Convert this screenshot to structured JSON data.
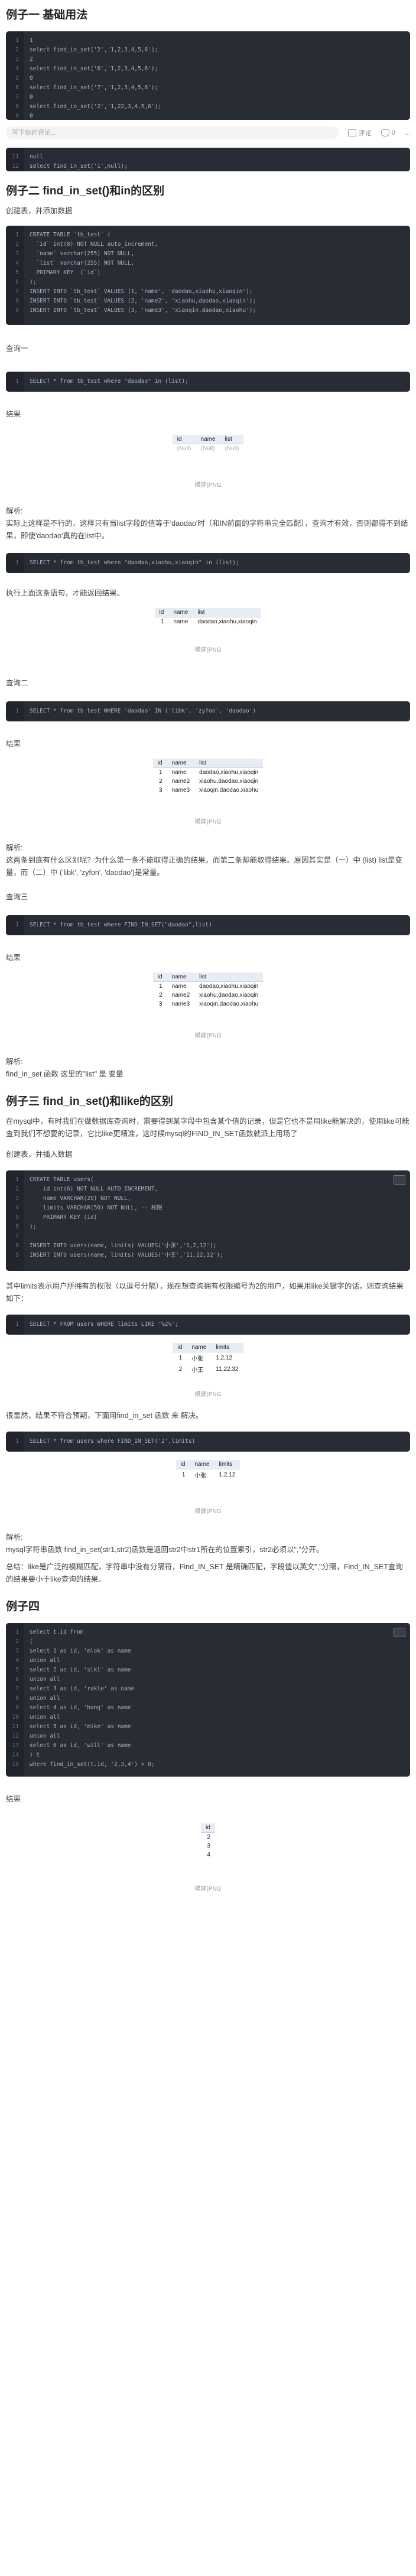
{
  "example1": {
    "title": "例子一 基础用法",
    "code_top": [
      {
        "n": "1",
        "t": "1"
      },
      {
        "n": "2",
        "t": "select find_in_set('2','1,2,3,4,5,6');"
      },
      {
        "n": "3",
        "t": "2"
      },
      {
        "n": "4",
        "t": "select find_in_set('6','1,2,3,4,5,6');"
      },
      {
        "n": "5",
        "t": "0"
      },
      {
        "n": "6",
        "t": "select find_in_set('7','1,2,3,4,5,6');"
      },
      {
        "n": "7",
        "t": "0"
      },
      {
        "n": "8",
        "t": "select find_in_set('2','1,22,3,4,5,6');"
      },
      {
        "n": "9",
        "t": "0"
      }
    ],
    "code_bottom": [
      {
        "n": "11",
        "t": "null"
      },
      {
        "n": "12",
        "t": "select find_in_set('1',null);"
      }
    ]
  },
  "toolbar": {
    "comment_placeholder": "写下你的评论...",
    "comment_label": "评论",
    "like_label": "0",
    "more_label": "..."
  },
  "example2": {
    "title": "例子二 find_in_set()和in的区别",
    "intro": "创建表，并添加数据",
    "code": [
      {
        "n": "1",
        "t": "CREATE TABLE `tb_test` ("
      },
      {
        "n": "2",
        "t": "  `id` int(8) NOT NULL auto_increment,"
      },
      {
        "n": "3",
        "t": "  `name` varchar(255) NOT NULL,"
      },
      {
        "n": "4",
        "t": "  `list` varchar(255) NOT NULL,"
      },
      {
        "n": "5",
        "t": "  PRIMARY KEY  (`id`)"
      },
      {
        "n": "6",
        "t": ");"
      },
      {
        "n": "7",
        "t": "INSERT INTO `tb_test` VALUES (1, 'name', 'daodao,xiaohu,xiaoqin');"
      },
      {
        "n": "8",
        "t": "INSERT INTO `tb_test` VALUES (2, 'name2', 'xiaohu,daodao,xiaoqin');"
      },
      {
        "n": "9",
        "t": "INSERT INTO `tb_test` VALUES (3, 'name3', 'xiaoqin,daodao,xiaohu');"
      }
    ],
    "q1_label": "查询一",
    "q1_code": "SELECT * from tb_test where \"daodao\" in (list);",
    "result_label": "结果",
    "t1": {
      "headers": [
        "id",
        "name",
        "list"
      ],
      "rows": [
        [
          "(Null)",
          "(Null)",
          "(Null)"
        ]
      ]
    },
    "caption": "横屏(PNG",
    "analysis_label": "解析:",
    "analysis1": "实际上这样是不行的，这样只有当list字段的值等于'daodao'时（和IN前面的字符串完全匹配），查询才有效，否则都得不到结果，即使'daodao'真的在list中。",
    "q2_code": "SELECT * from tb_test where \"daodao,xiaohu,xiaoqin\" in (list);",
    "q2_text": "执行上面这条语句，才能返回结果。",
    "t2": {
      "headers": [
        "id",
        "name",
        "list"
      ],
      "rows": [
        [
          "1",
          "name",
          "daodao,xiaohu,xiaoqin"
        ]
      ]
    },
    "q3_label": "查询二",
    "q3_code": "SELECT * from tb_test WHERE 'daodao' IN ('libk', 'zyfon', 'daodao')",
    "t3": {
      "headers": [
        "id",
        "name",
        "list"
      ],
      "rows": [
        [
          "1",
          "name",
          "daodao,xiaohu,xiaoqin"
        ],
        [
          "2",
          "name2",
          "xiaohu,daodao,xiaoqin"
        ],
        [
          "3",
          "name3",
          "xiaoqin,daodao,xiaohu"
        ]
      ]
    },
    "analysis3": "这两条到底有什么区别呢？为什么第一条不能取得正确的结果，而第二条却能取得结果。原因其实是（一）中 (list) list是变量，而（二）中 ('libk', 'zyfon', 'daodao')是常量。",
    "q4_label": "查询三",
    "q4_code": "SELECT * from tb_test where FIND_IN_SET(\"daodao\",list)",
    "t4": {
      "headers": [
        "id",
        "name",
        "list"
      ],
      "rows": [
        [
          "1",
          "name",
          "daodao,xiaohu,xiaoqin"
        ],
        [
          "2",
          "name2",
          "xiaohu,daodao,xiaoqin"
        ],
        [
          "3",
          "name3",
          "xiaoqin,daodao,xiaohu"
        ]
      ]
    },
    "analysis4": "find_in_set 函数 这里的\"list\" 是 变量"
  },
  "example3": {
    "title": "例子三 find_in_set()和like的区别",
    "text1": "在mysql中，有时我们在做数据库查询时，需要得到某字段中包含某个值的记录，但是它也不是用like能解决的，使用like可能查到我们不想要的记录，它比like更精准，这时候mysql的FIND_IN_SET函数就派上用场了",
    "intro": "创建表，并插入数据",
    "code": [
      {
        "n": "1",
        "t": "CREATE TABLE users("
      },
      {
        "n": "2",
        "t": "    id int(6) NOT NULL AUTO_INCREMENT,"
      },
      {
        "n": "3",
        "t": "    name VARCHAR(20) NOT NULL,"
      },
      {
        "n": "4",
        "t": "    limits VARCHAR(50) NOT NULL, -- 权限"
      },
      {
        "n": "5",
        "t": "    PRIMARY KEY (id)"
      },
      {
        "n": "6",
        "t": ");"
      },
      {
        "n": "7",
        "t": ""
      },
      {
        "n": "8",
        "t": "INSERT INTO users(name, limits) VALUES('小张','1,2,12');"
      },
      {
        "n": "9",
        "t": "INSERT INTO users(name, limits) VALUES('小王','11,22,32');"
      }
    ],
    "text2": "其中limits表示用户所拥有的权限（以逗号分隔），现在想查询拥有权限编号为2的用户，如果用like关键字的话，则查询结果如下：",
    "q1_code": "SELECT * FROM users WHERE limits LIKE '%2%';",
    "t1": {
      "headers": [
        "id",
        "name",
        "limits"
      ],
      "rows": [
        [
          "1",
          "小张",
          "1,2,12"
        ],
        [
          "2",
          "小王",
          "11,22,32"
        ]
      ]
    },
    "text3": "很显然，结果不符合预期，下面用find_in_set 函数 来 解决。",
    "q2_code": "SELECT * from users where FIND_IN_SET('2',limits)",
    "t2": {
      "headers": [
        "id",
        "name",
        "limits"
      ],
      "rows": [
        [
          "1",
          "小张",
          "1,2,12"
        ]
      ]
    },
    "analysis_label": "解析:",
    "analysis1": "mysql字符串函数 find_in_set(str1,str2)函数是返回str2中str1所在的位置索引，str2必须以\",\"分开。",
    "analysis2": "总结：like是广泛的模糊匹配，字符串中没有分隔符，Find_IN_SET 是精确匹配，字段值以英文\",\"分隔，Find_IN_SET查询的结果要小于like查询的结果。"
  },
  "example4": {
    "title": "例子四",
    "code": [
      {
        "n": "1",
        "t": "select t.id from"
      },
      {
        "n": "2",
        "t": "("
      },
      {
        "n": "3",
        "t": "select 1 as id, 'mlok' as name"
      },
      {
        "n": "4",
        "t": "union all"
      },
      {
        "n": "5",
        "t": "select 2 as id, 'slkl' as name"
      },
      {
        "n": "6",
        "t": "union all"
      },
      {
        "n": "7",
        "t": "select 3 as id, 'rakle' as name"
      },
      {
        "n": "8",
        "t": "union all"
      },
      {
        "n": "9",
        "t": "select 4 as id, 'hang' as name"
      },
      {
        "n": "10",
        "t": "union all"
      },
      {
        "n": "11",
        "t": "select 5 as id, 'mike' as name"
      },
      {
        "n": "12",
        "t": "union all"
      },
      {
        "n": "13",
        "t": "select 6 as id, 'will' as name"
      },
      {
        "n": "14",
        "t": ") t"
      },
      {
        "n": "15",
        "t": "where find_in_set(t.id, '2,3,4') > 0;"
      }
    ],
    "result_label": "结果",
    "t1": {
      "headers": [
        "id"
      ],
      "rows": [
        [
          "2"
        ],
        [
          "3"
        ],
        [
          "4"
        ]
      ]
    }
  }
}
